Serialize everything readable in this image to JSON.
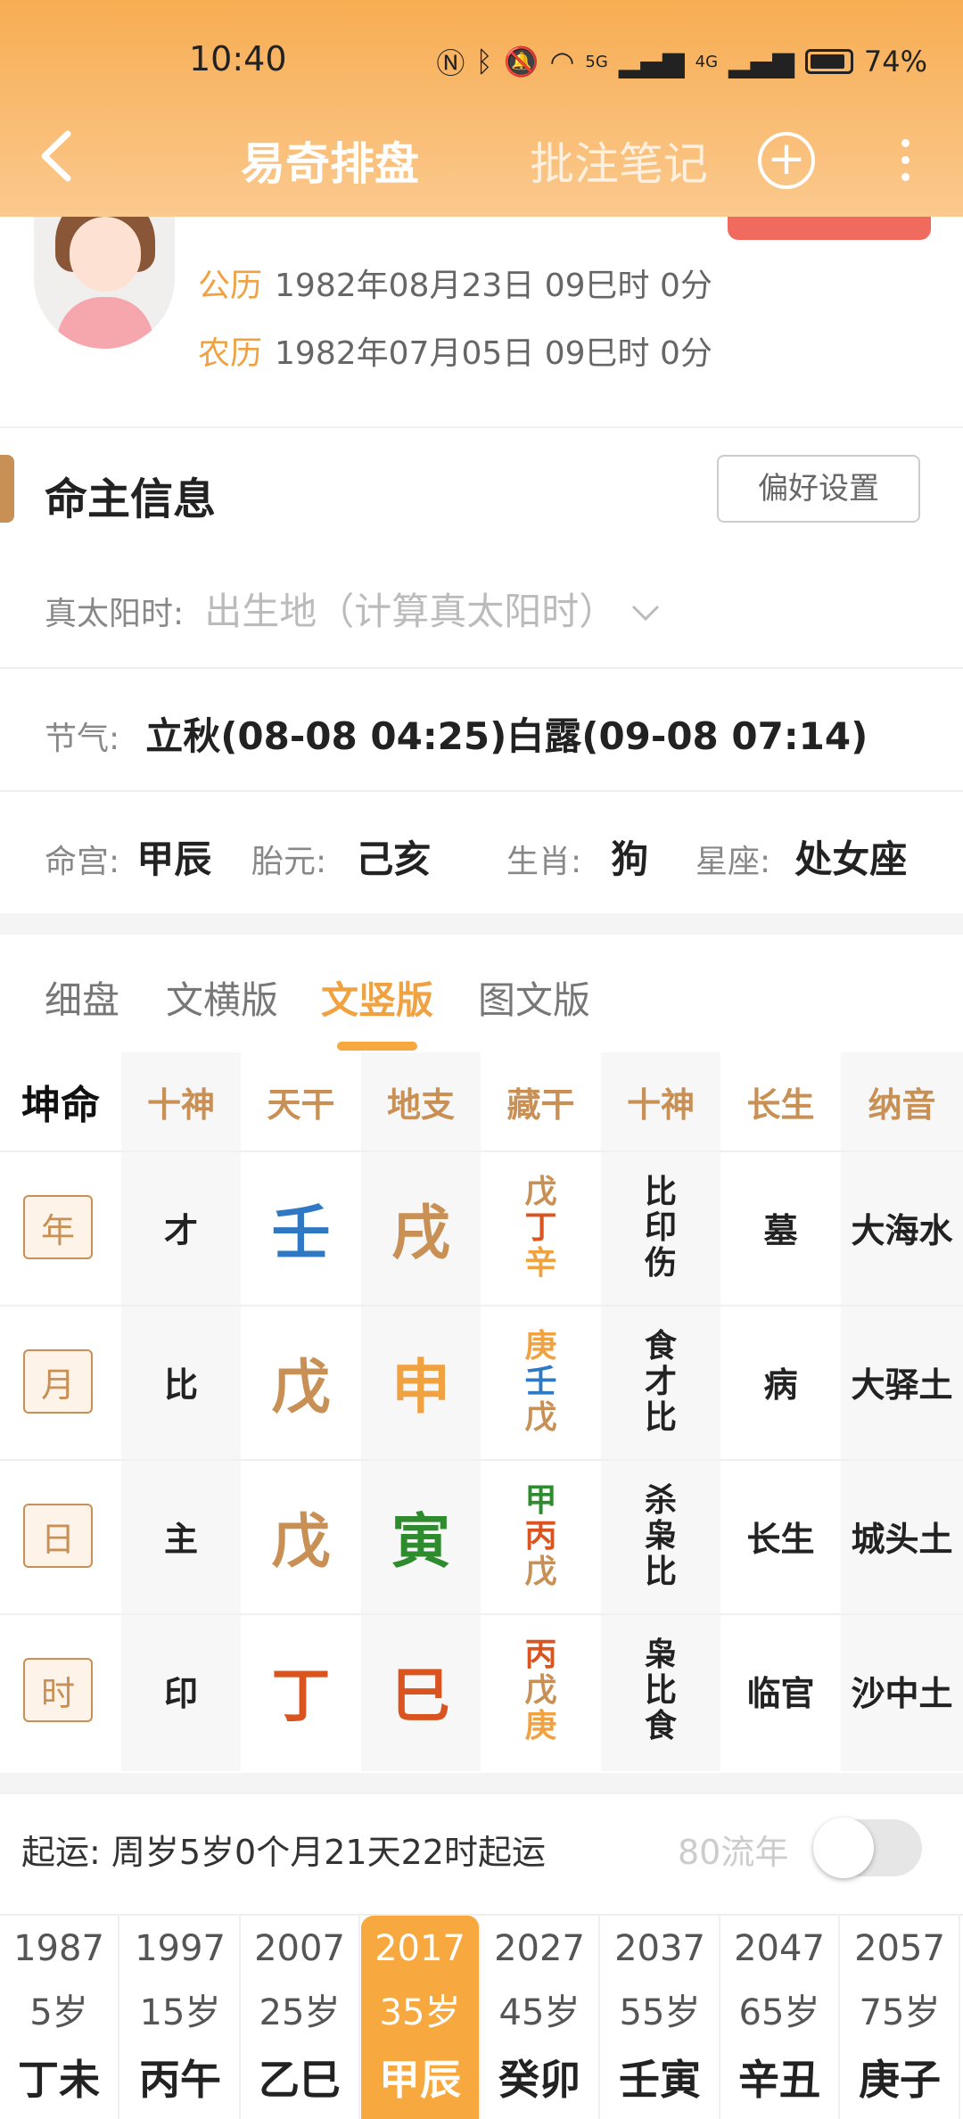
{
  "status": {
    "time": "10:40",
    "battery": "74%",
    "net1": "5G",
    "net2": "4G"
  },
  "nav": {
    "title": "易奇排盘",
    "notes": "批注笔记"
  },
  "profile": {
    "solar_label": "公历",
    "solar_value": "1982年08月23日 09巳时 0分",
    "lunar_label": "农历",
    "lunar_value": "1982年07月05日 09巳时 0分"
  },
  "section": {
    "title": "命主信息",
    "pref_button": "偏好设置"
  },
  "info": {
    "true_sun_label": "真太阳时:",
    "true_sun_placeholder": "出生地（计算真太阳时）",
    "jieqi_label": "节气:",
    "jieqi_value": "立秋(08-08 04:25)白露(09-08 07:14)",
    "minggong_label": "命宫:",
    "minggong_value": "甲辰",
    "taiyuan_label": "胎元:",
    "taiyuan_value": "己亥",
    "shengxiao_label": "生肖:",
    "shengxiao_value": "狗",
    "xingzuo_label": "星座:",
    "xingzuo_value": "处女座"
  },
  "tabs": [
    "细盘",
    "文横版",
    "文竖版",
    "图文版"
  ],
  "active_tab": "文竖版",
  "grid": {
    "corner": "坤命",
    "headers": [
      "十神",
      "天干",
      "地支",
      "藏干",
      "十神",
      "长生",
      "纳音"
    ],
    "rows": [
      {
        "pillar": "年",
        "shishen": "才",
        "gan": "壬",
        "zhi": "戌",
        "canggan": [
          "戊",
          "丁",
          "辛"
        ],
        "canggan_shishen": [
          "比",
          "印",
          "伤"
        ],
        "changsheng": "墓",
        "nayin": "大海水"
      },
      {
        "pillar": "月",
        "shishen": "比",
        "gan": "戊",
        "zhi": "申",
        "canggan": [
          "庚",
          "壬",
          "戊"
        ],
        "canggan_shishen": [
          "食",
          "才",
          "比"
        ],
        "changsheng": "病",
        "nayin": "大驿土"
      },
      {
        "pillar": "日",
        "shishen": "主",
        "gan": "戊",
        "zhi": "寅",
        "canggan": [
          "甲",
          "丙",
          "戊"
        ],
        "canggan_shishen": [
          "杀",
          "枭",
          "比"
        ],
        "changsheng": "长生",
        "nayin": "城头土"
      },
      {
        "pillar": "时",
        "shishen": "印",
        "gan": "丁",
        "zhi": "巳",
        "canggan": [
          "丙",
          "戊",
          "庚"
        ],
        "canggan_shishen": [
          "枭",
          "比",
          "食"
        ],
        "changsheng": "临官",
        "nayin": "沙中土"
      }
    ],
    "colors": {
      "壬": "#2f78c4",
      "戊": "#c89054",
      "丁": "#d9541e",
      "戌": "#c89054",
      "申": "#f0a140",
      "寅": "#2e8b2e",
      "巳": "#d9541e",
      "庚": "#f0a140",
      "辛": "#f0a140",
      "甲": "#2e8b2e",
      "丙": "#d9541e"
    }
  },
  "qiyun": {
    "text": "起运:  周岁5岁0个月21天22时起运",
    "liunian": "80流年",
    "toggle_on": false
  },
  "dayun": [
    {
      "year": "1987",
      "age": "5岁",
      "gz": "丁未"
    },
    {
      "year": "1997",
      "age": "15岁",
      "gz": "丙午"
    },
    {
      "year": "2007",
      "age": "25岁",
      "gz": "乙巳"
    },
    {
      "year": "2017",
      "age": "35岁",
      "gz": "甲辰",
      "active": true
    },
    {
      "year": "2027",
      "age": "45岁",
      "gz": "癸卯"
    },
    {
      "year": "2037",
      "age": "55岁",
      "gz": "壬寅"
    },
    {
      "year": "2047",
      "age": "65岁",
      "gz": "辛丑"
    },
    {
      "year": "2057",
      "age": "75岁",
      "gz": "庚子"
    }
  ]
}
